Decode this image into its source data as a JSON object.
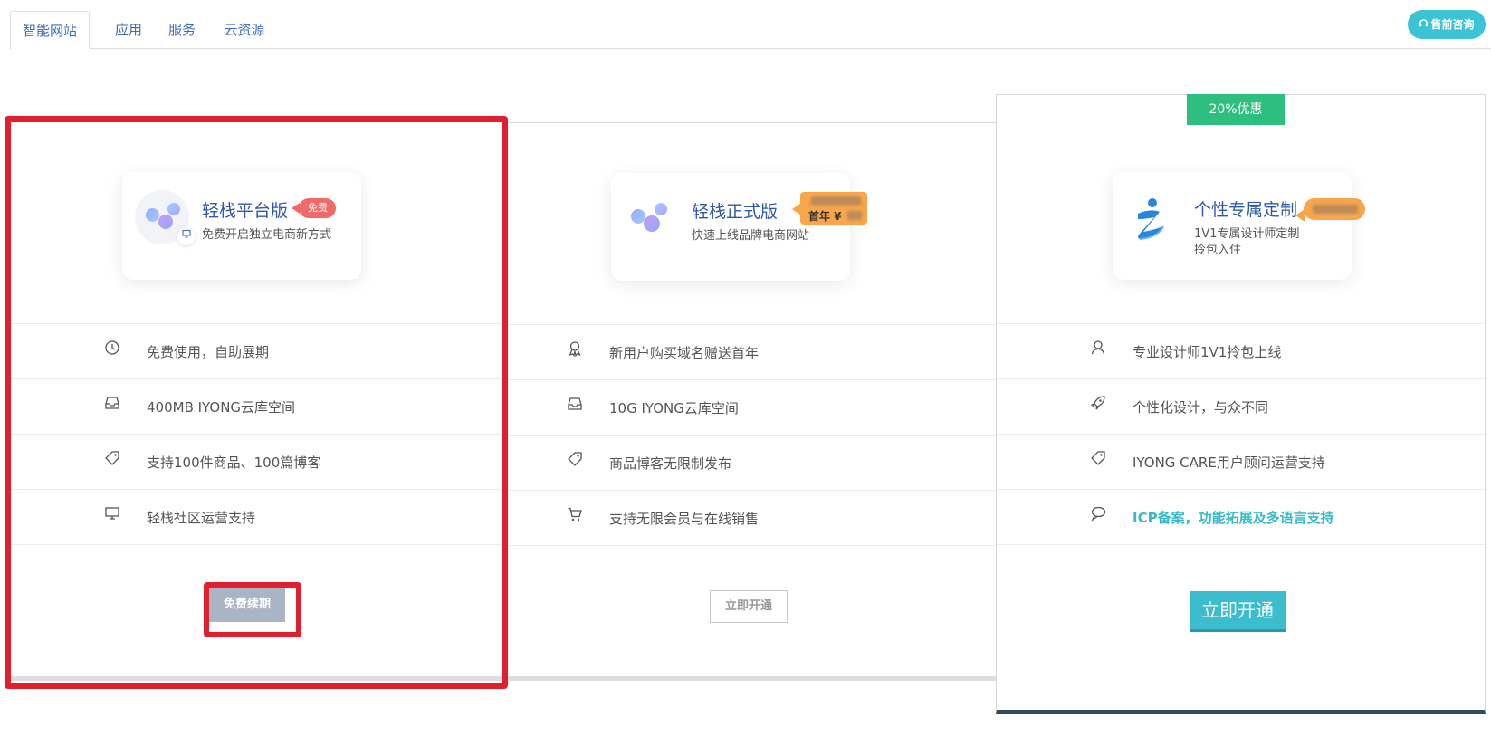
{
  "tabs": [
    {
      "label": "智能网站",
      "active": true
    },
    {
      "label": "应用",
      "active": false
    },
    {
      "label": "服务",
      "active": false
    },
    {
      "label": "云资源",
      "active": false
    }
  ],
  "consult_button": {
    "label": "售前咨询",
    "icon": "headphones-icon"
  },
  "colors": {
    "accent": "#3cc3d5",
    "highlight": "#e1202f",
    "discount": "#2dbf7d",
    "title": "#3159a8"
  },
  "plans": [
    {
      "title": "轻栈平台版",
      "badge": "免费",
      "subtitle": "免费开启独立电商新方式",
      "features": [
        {
          "icon": "clock-icon",
          "text": "免费使用，自助展期"
        },
        {
          "icon": "inbox-icon",
          "text": "400MB IYONG云库空间"
        },
        {
          "icon": "tag-icon",
          "text": "支持100件商品、100篇博客"
        },
        {
          "icon": "monitor-icon",
          "text": "轻栈社区运营支持"
        }
      ],
      "button": "免费续期"
    },
    {
      "title": "轻栈正式版",
      "badge": "首年 ¥",
      "subtitle": "快速上线品牌电商网站",
      "features": [
        {
          "icon": "award-icon",
          "text": "新用户购买域名赠送首年"
        },
        {
          "icon": "inbox-icon",
          "text": "10G IYONG云库空间"
        },
        {
          "icon": "tag-icon",
          "text": "商品博客无限制发布"
        },
        {
          "icon": "cart-icon",
          "text": "支持无限会员与在线销售"
        }
      ],
      "button": "立即开通"
    },
    {
      "discount": "20%优惠",
      "title": "个性专属定制",
      "subtitle_line1": "1V1专属设计师定制",
      "subtitle_line2": "拎包入住",
      "features": [
        {
          "icon": "user-icon",
          "text": "专业设计师1V1拎包上线"
        },
        {
          "icon": "rocket-icon",
          "text": "个性化设计，与众不同"
        },
        {
          "icon": "tag-icon",
          "text": "IYONG CARE用户顾问运营支持"
        },
        {
          "icon": "chat-icon",
          "text": "ICP备案，功能拓展及多语言支持"
        }
      ],
      "button": "立即开通"
    }
  ]
}
